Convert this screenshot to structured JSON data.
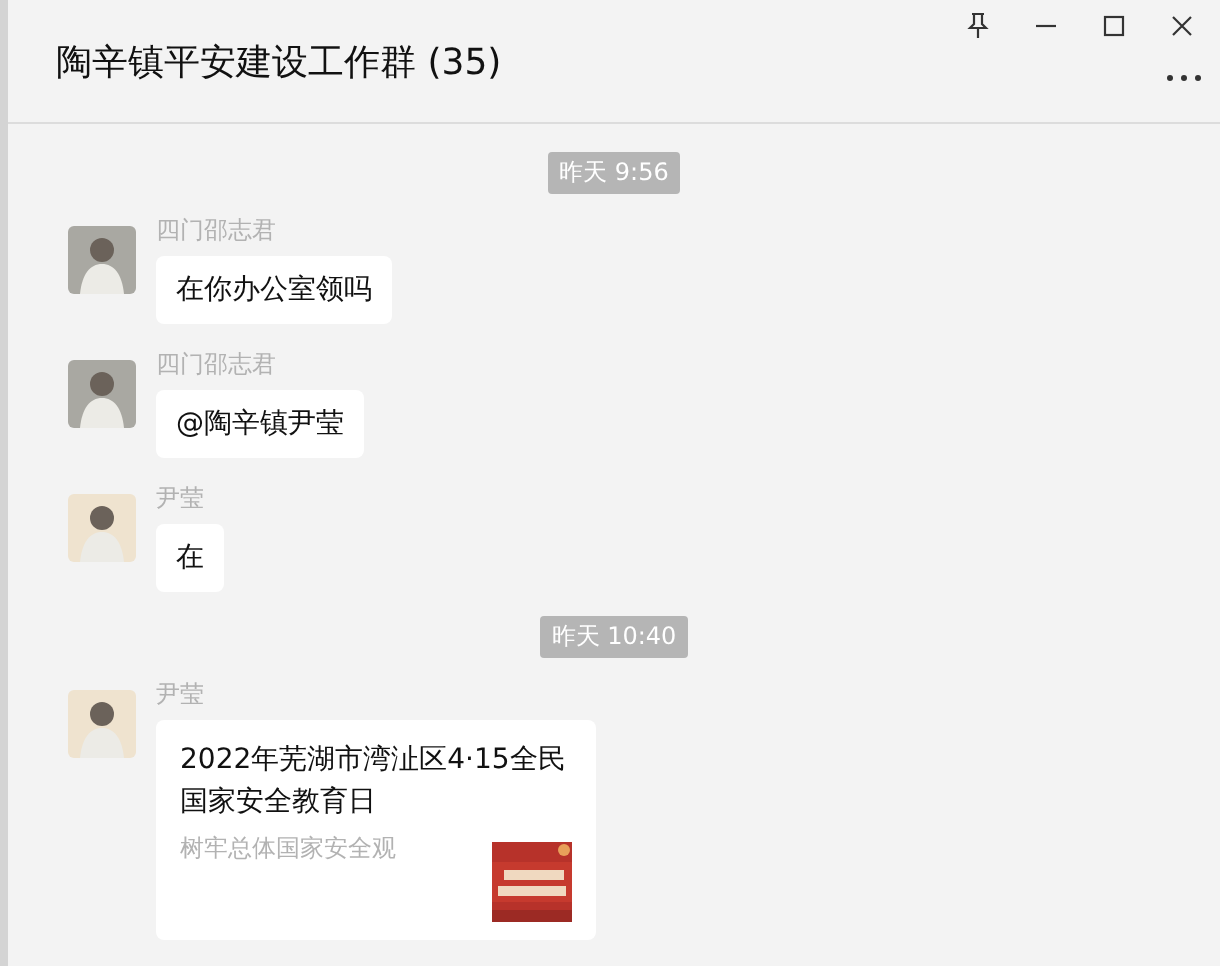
{
  "window": {
    "title": "陶辛镇平安建设工作群 (35)"
  },
  "messages": [
    {
      "kind": "time",
      "text": "昨天 9:56"
    },
    {
      "kind": "text",
      "sender": "四门邵志君",
      "color": "#a9a8a2",
      "text": "在你办公室领吗"
    },
    {
      "kind": "text",
      "sender": "四门邵志君",
      "color": "#a9a8a2",
      "text": "@陶辛镇尹莹"
    },
    {
      "kind": "text",
      "sender": "尹莹",
      "color": "#efe3cf",
      "text": "在"
    },
    {
      "kind": "time",
      "text": "昨天 10:40"
    },
    {
      "kind": "link",
      "sender": "尹莹",
      "color": "#efe3cf",
      "title": "2022年芜湖市湾沚区4·15全民国家安全教育日",
      "description": "树牢总体国家安全观"
    }
  ]
}
